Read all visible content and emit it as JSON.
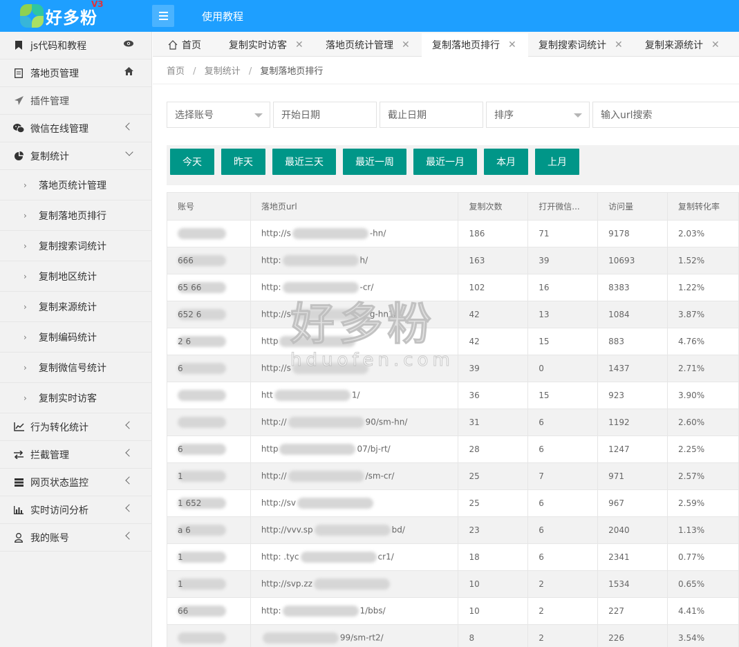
{
  "header": {
    "logo_text": "好多粉",
    "logo_version": "V3",
    "link": "使用教程"
  },
  "sidebar": {
    "items": [
      {
        "label": "js代码和教程",
        "icon": "bookmark-icon"
      },
      {
        "label": "落地页管理",
        "icon": "page-icon"
      },
      {
        "label": "插件管理",
        "icon": "paper-plane-icon"
      },
      {
        "label": "微信在线管理",
        "icon": "wechat-icon"
      },
      {
        "label": "复制统计",
        "icon": "pie-chart-icon"
      }
    ],
    "subitems": [
      "落地页统计管理",
      "复制落地页排行",
      "复制搜索词统计",
      "复制地区统计",
      "复制来源统计",
      "复制编码统计",
      "复制微信号统计",
      "复制实时访客"
    ],
    "items2": [
      {
        "label": "行为转化统计",
        "icon": "line-chart-icon"
      },
      {
        "label": "拦截管理",
        "icon": "exchange-icon"
      },
      {
        "label": "网页状态监控",
        "icon": "server-icon"
      },
      {
        "label": "实时访问分析",
        "icon": "bar-chart-icon"
      },
      {
        "label": "我的账号",
        "icon": "user-icon"
      }
    ]
  },
  "tabs": [
    {
      "label": "首页"
    },
    {
      "label": "复制实时访客"
    },
    {
      "label": "落地页统计管理"
    },
    {
      "label": "复制落地页排行"
    },
    {
      "label": "复制搜索词统计"
    },
    {
      "label": "复制来源统计"
    }
  ],
  "breadcrumb": [
    "首页",
    "复制统计",
    "复制落地页排行"
  ],
  "breadcrumb_sep": "/",
  "filters": {
    "account": "选择账号",
    "start_date": "开始日期",
    "end_date": "截止日期",
    "sort": "排序",
    "url_search": "输入url搜索"
  },
  "quick_buttons": [
    "今天",
    "昨天",
    "最近三天",
    "最近一周",
    "最近一月",
    "本月",
    "上月"
  ],
  "table": {
    "headers": [
      "账号",
      "落地页url",
      "复制次数",
      "打开微信...",
      "访问量",
      "复制转化率"
    ],
    "rows": [
      {
        "acct": "",
        "url_prefix": "http://s",
        "url_suffix": "-hn/",
        "copies": "186",
        "opened": "71",
        "visits": "9178",
        "rate": "2.03%"
      },
      {
        "acct": "666",
        "url_prefix": "http:",
        "url_suffix": "h/",
        "copies": "163",
        "opened": "39",
        "visits": "10693",
        "rate": "1.52%"
      },
      {
        "acct": "65 66",
        "url_prefix": "http:",
        "url_suffix": "-cr/",
        "copies": "102",
        "opened": "16",
        "visits": "8383",
        "rate": "1.22%"
      },
      {
        "acct": "652 6",
        "url_prefix": "http://s",
        "url_suffix": "g-hn1/",
        "copies": "42",
        "opened": "13",
        "visits": "1084",
        "rate": "3.87%"
      },
      {
        "acct": "2 6",
        "url_prefix": "http",
        "url_suffix": "",
        "copies": "42",
        "opened": "15",
        "visits": "883",
        "rate": "4.76%"
      },
      {
        "acct": "6",
        "url_prefix": "http://s",
        "url_suffix": "",
        "copies": "39",
        "opened": "0",
        "visits": "1437",
        "rate": "2.71%"
      },
      {
        "acct": "",
        "url_prefix": "htt",
        "url_suffix": "1/",
        "copies": "36",
        "opened": "15",
        "visits": "923",
        "rate": "3.90%"
      },
      {
        "acct": "",
        "url_prefix": "http://",
        "url_suffix": "90/sm-hn/",
        "copies": "31",
        "opened": "6",
        "visits": "1192",
        "rate": "2.60%"
      },
      {
        "acct": "6",
        "url_prefix": "http",
        "url_suffix": "07/bj-rt/",
        "copies": "28",
        "opened": "6",
        "visits": "1247",
        "rate": "2.25%"
      },
      {
        "acct": "1",
        "url_prefix": "http://",
        "url_suffix": "/sm-cr/",
        "copies": "25",
        "opened": "7",
        "visits": "971",
        "rate": "2.57%"
      },
      {
        "acct": "1 652",
        "url_prefix": "http://sv",
        "url_suffix": "",
        "copies": "25",
        "opened": "6",
        "visits": "967",
        "rate": "2.59%"
      },
      {
        "acct": "a 6",
        "url_prefix": "http://vvv.sp",
        "url_suffix": "bd/",
        "copies": "23",
        "opened": "6",
        "visits": "2040",
        "rate": "1.13%"
      },
      {
        "acct": "1",
        "url_prefix": "http: .tyc",
        "url_suffix": "cr1/",
        "copies": "18",
        "opened": "6",
        "visits": "2341",
        "rate": "0.77%"
      },
      {
        "acct": "1",
        "url_prefix": "http://svp.zz",
        "url_suffix": "",
        "copies": "10",
        "opened": "2",
        "visits": "1534",
        "rate": "0.65%"
      },
      {
        "acct": "66",
        "url_prefix": "http:",
        "url_suffix": "1/bbs/",
        "copies": "10",
        "opened": "2",
        "visits": "227",
        "rate": "4.41%"
      },
      {
        "acct": "",
        "url_prefix": "",
        "url_suffix": "99/sm-rt2/",
        "copies": "8",
        "opened": "2",
        "visits": "226",
        "rate": "3.54%"
      }
    ]
  },
  "watermark": {
    "cn": "好多粉",
    "en": "hduofen.com"
  },
  "colors": {
    "header": "#1e9fff",
    "button": "#009688",
    "logo_version": "#e0323b"
  }
}
